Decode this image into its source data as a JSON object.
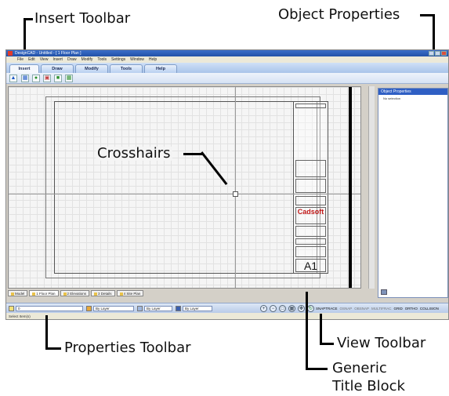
{
  "callouts": {
    "insert_toolbar": "Insert Toolbar",
    "object_properties": "Object Properties",
    "crosshairs": "Crosshairs",
    "properties_toolbar": "Properties Toolbar",
    "view_toolbar": "View Toolbar",
    "generic_title_block_line1": "Generic",
    "generic_title_block_line2": "Title Block"
  },
  "app": {
    "title": "DesignCAD - Untitled - [ 1 Floor Plan ]",
    "menu": [
      "File",
      "Edit",
      "View",
      "Insert",
      "Draw",
      "Modify",
      "Tools",
      "Settings",
      "Window",
      "Help"
    ],
    "ribbon_tabs": [
      "Insert",
      "Draw",
      "Modify",
      "Tools",
      "Help"
    ]
  },
  "object_properties": {
    "header": "Object Properties",
    "row": "No selection"
  },
  "title_block": {
    "logo": "Cadsoft",
    "sheet_size": "A1"
  },
  "sheet_tabs": [
    "Model",
    "1 Floor Plan",
    "2 Elevations",
    "3 Details",
    "4 Site Plan"
  ],
  "properties_toolbar": {
    "layer": "0",
    "color": "By Layer",
    "linetype": "By Layer",
    "lineweight": "By Layer"
  },
  "status": {
    "prompt": "Select Item(s)",
    "modes": [
      "SNAPTRACE",
      "OSNAP",
      "OBSNAP",
      "MULTIFRAC",
      "GRID",
      "ORTHO",
      "COLLISION"
    ]
  },
  "colors": {
    "ribbon": "#a9c4ea",
    "panel_header": "#2f5fc4",
    "logo_red": "#c01818"
  }
}
